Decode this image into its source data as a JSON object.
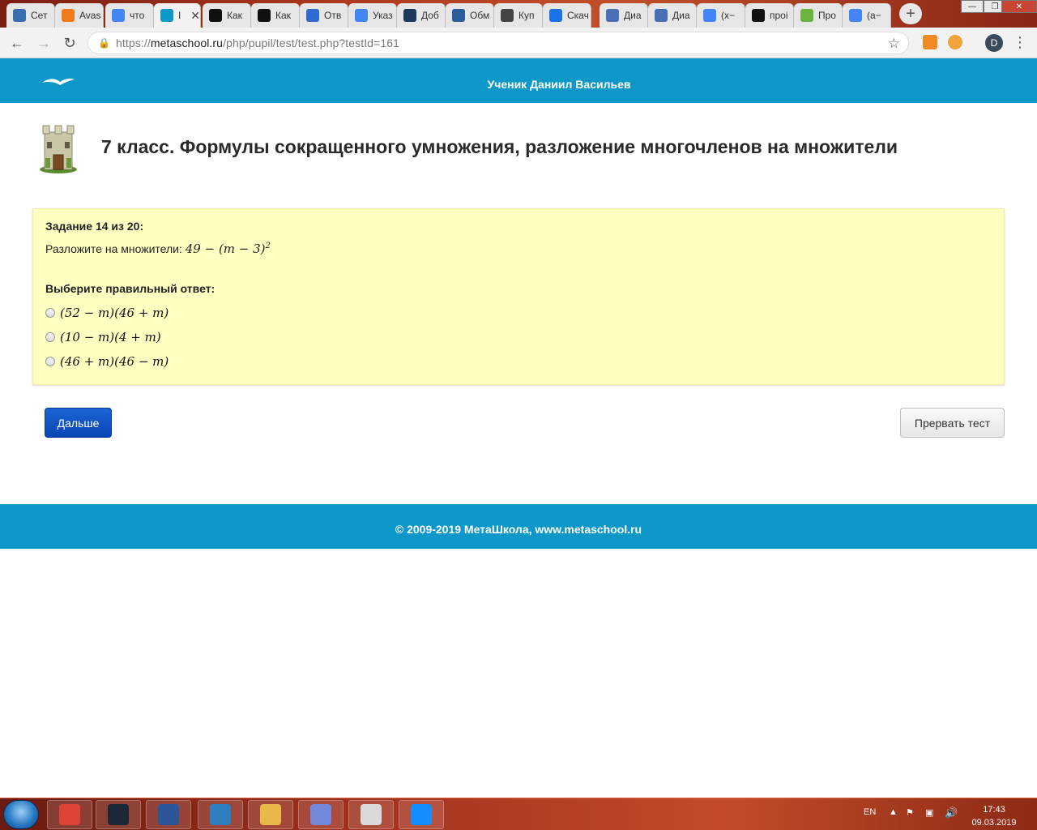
{
  "browser": {
    "tabs": [
      {
        "title": "Сет",
        "icon": "windows-network-icon",
        "color": "#3a6fb0"
      },
      {
        "title": "Avas",
        "icon": "avast-icon",
        "color": "#f07b1c"
      },
      {
        "title": "что",
        "icon": "google-icon",
        "color": "#4285f4"
      },
      {
        "title": "I",
        "icon": "metaschool-icon",
        "color": "#0d98c9",
        "active": true
      },
      {
        "title": "Как",
        "icon": "znanija-icon",
        "color": "#111111"
      },
      {
        "title": "Как",
        "icon": "znanija-icon",
        "color": "#111111"
      },
      {
        "title": "Отв",
        "icon": "question-icon",
        "color": "#2f6bd0"
      },
      {
        "title": "Указ",
        "icon": "google-icon",
        "color": "#4285f4"
      },
      {
        "title": "Доб",
        "icon": "steam-icon",
        "color": "#1b3a5c"
      },
      {
        "title": "Обм",
        "icon": "exchange-icon",
        "color": "#2b5d9a"
      },
      {
        "title": "Куп",
        "icon": "skull-icon",
        "color": "#444444"
      },
      {
        "title": "Скач",
        "icon": "download-icon",
        "color": "#1a73e8"
      },
      {
        "title": "Диа",
        "icon": "chat-icon",
        "color": "#4a6fb5"
      },
      {
        "title": "Диа",
        "icon": "chat-icon",
        "color": "#4a6fb5"
      },
      {
        "title": "(x−",
        "icon": "google-icon",
        "color": "#4285f4"
      },
      {
        "title": "проі",
        "icon": "znanija-icon",
        "color": "#111111"
      },
      {
        "title": "Про",
        "icon": "apple-icon",
        "color": "#6cb33f"
      },
      {
        "title": "(a−",
        "icon": "google-icon",
        "color": "#4285f4"
      }
    ],
    "url_scheme": "https://",
    "url_host": "metaschool.ru",
    "url_path": "/php/pupil/test/test.php?testId=161",
    "profile_initial": "D"
  },
  "header": {
    "pupil_label": "Ученик  Даниил Васильев"
  },
  "page": {
    "title": "7 класс. Формулы сокращенного умножения, разложение многочленов на множители"
  },
  "task": {
    "number_label": "Задание 14 из 20:",
    "prompt": "Разложите на множители: ",
    "expression": "49 − (m − 3)",
    "exponent": "2",
    "choose_label": "Выберите правильный ответ:",
    "options": [
      "(52 − m)(46 + m)",
      "(10 − m)(4 + m)",
      "(46 + m)(46 − m)"
    ]
  },
  "buttons": {
    "next": "Дальше",
    "abort": "Прервать тест"
  },
  "footer": {
    "copyright": "© 2009-2019 МетаШкола, www.metaschool.ru"
  },
  "taskbar": {
    "apps": [
      {
        "name": "chrome-icon",
        "color": "#db4437"
      },
      {
        "name": "steam-icon",
        "color": "#1b2838"
      },
      {
        "name": "word-icon",
        "color": "#2b579a"
      },
      {
        "name": "remote-desktop-icon",
        "color": "#2f7fc0"
      },
      {
        "name": "explorer-folder-icon",
        "color": "#e8b84a"
      },
      {
        "name": "discord-icon",
        "color": "#7289da"
      },
      {
        "name": "paint-icon",
        "color": "#d9d9d9"
      },
      {
        "name": "battlenet-icon",
        "color": "#148eff"
      }
    ],
    "language": "EN",
    "time": "17:43",
    "date": "09.03.2019"
  }
}
